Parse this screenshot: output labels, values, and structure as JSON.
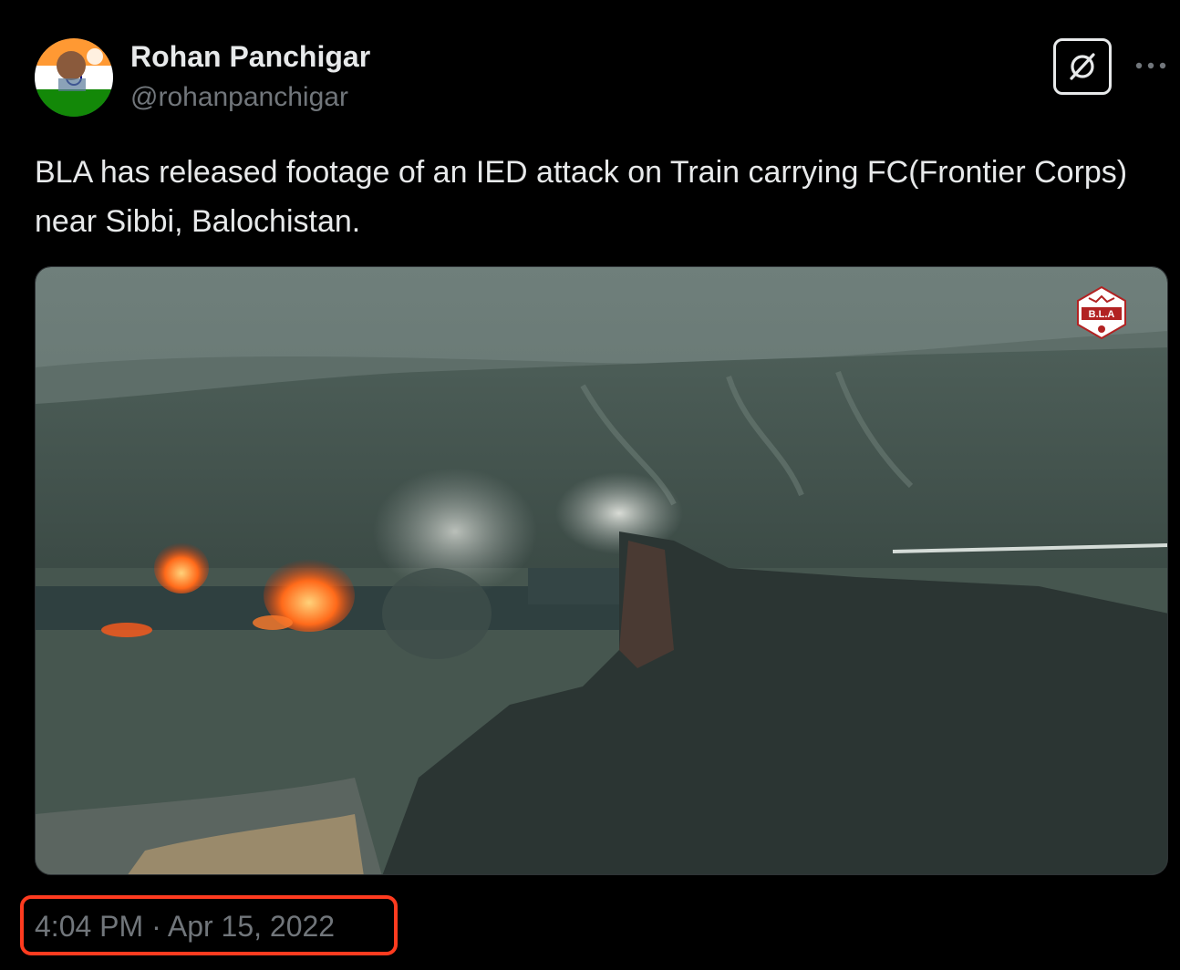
{
  "author": {
    "name": "Rohan Panchigar",
    "handle": "@rohanpanchigar"
  },
  "tweet": {
    "text": "BLA has released footage of an IED attack on Train carrying FC(Frontier Corps) near Sibbi, Balochistan.",
    "timestamp": "4:04 PM · Apr 15, 2022"
  },
  "media": {
    "watermark_text": "B.L.A"
  },
  "icons": {
    "grok": "grok-icon",
    "more": "more-options-icon"
  },
  "colors": {
    "background": "#000000",
    "text_primary": "#e7e9ea",
    "text_secondary": "#71767b",
    "highlight_box": "#ff3b1f"
  }
}
